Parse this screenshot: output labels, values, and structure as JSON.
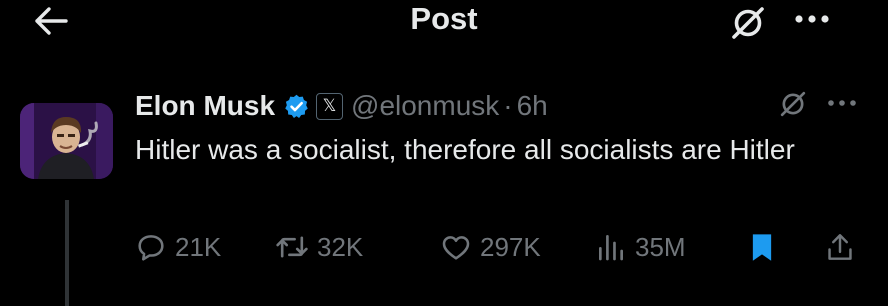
{
  "header": {
    "title": "Post"
  },
  "post": {
    "author_name": "Elon Musk",
    "affiliation_badge": "𝕏",
    "handle": "@elonmusk",
    "separator": "·",
    "time": "6h",
    "text": "Hitler was a socialist, therefore all socialists are Hitler"
  },
  "actions": {
    "replies": "21K",
    "reposts": "32K",
    "likes": "297K",
    "views": "35M"
  },
  "colors": {
    "background": "#000000",
    "text": "#e7e9ea",
    "muted": "#71767b",
    "verified": "#1d9bf0",
    "bookmark": "#1d9bf0"
  },
  "icons": {
    "back": "arrow-left-icon",
    "grok": "grok-icon",
    "more": "more-icon",
    "verified": "verified-badge-icon",
    "reply": "reply-icon",
    "repost": "repost-icon",
    "like": "like-icon",
    "views": "views-icon",
    "bookmark": "bookmark-icon",
    "share": "share-icon"
  }
}
